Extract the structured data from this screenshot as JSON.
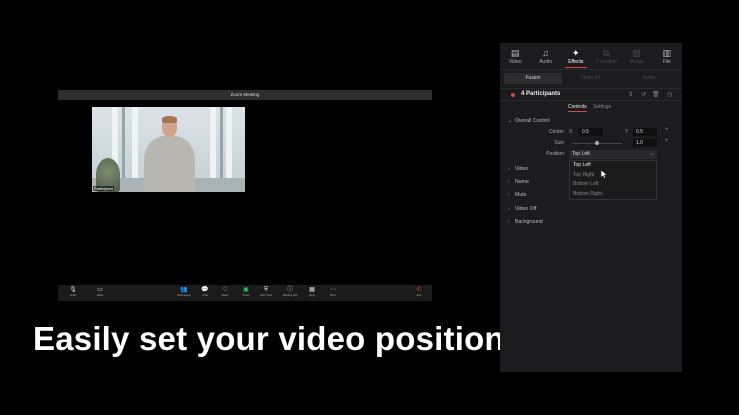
{
  "zoom": {
    "title": "Zoom Meeting",
    "participant_label": "Participant",
    "toolbar": [
      {
        "name": "audio",
        "icon": "microphone-icon",
        "glyph": "🎙",
        "label": "Audio"
      },
      {
        "name": "video",
        "icon": "camera-icon",
        "glyph": "▭",
        "label": "Video"
      },
      {
        "name": "participants",
        "icon": "people-icon",
        "glyph": "👥",
        "label": "Participants"
      },
      {
        "name": "chat",
        "icon": "chat-icon",
        "glyph": "💬",
        "label": "Chat"
      },
      {
        "name": "react",
        "icon": "heart-icon",
        "glyph": "♡",
        "label": "React"
      },
      {
        "name": "share",
        "icon": "share-screen-icon",
        "glyph": "▣",
        "label": "Share"
      },
      {
        "name": "host-tools",
        "icon": "shield-icon",
        "glyph": "⛨",
        "label": "Host Tools"
      },
      {
        "name": "meeting-info",
        "icon": "info-icon",
        "glyph": "ⓘ",
        "label": "Meeting Info"
      },
      {
        "name": "apps",
        "icon": "apps-icon",
        "glyph": "▦",
        "label": "Apps"
      },
      {
        "name": "more",
        "icon": "more-icon",
        "glyph": "⋯",
        "label": "More"
      },
      {
        "name": "leave",
        "icon": "leave-icon",
        "glyph": "✆",
        "label": "End"
      }
    ]
  },
  "headline": "Easily set your video position",
  "panel": {
    "tabs": [
      {
        "label": "Video",
        "icon": "video-icon",
        "glyph": "▤",
        "state": "normal"
      },
      {
        "label": "Audio",
        "icon": "music-note-icon",
        "glyph": "♫",
        "state": "normal"
      },
      {
        "label": "Effects",
        "icon": "magic-wand-icon",
        "glyph": "✦",
        "state": "active"
      },
      {
        "label": "Transition",
        "icon": "transition-icon",
        "glyph": "⧉",
        "state": "dim"
      },
      {
        "label": "Image",
        "icon": "image-icon",
        "glyph": "▨",
        "state": "dim"
      },
      {
        "label": "File",
        "icon": "file-icon",
        "glyph": "▥",
        "state": "normal"
      }
    ],
    "subtabs": [
      "Fusion",
      "Open FX",
      "Audio"
    ],
    "effect_title": "4 Participants",
    "control_tabs": {
      "controls": "Controls",
      "settings": "Settings"
    },
    "overall_control": "Overall Control",
    "params": {
      "center_label": "Center",
      "x_label": "X",
      "x_value": "0.5",
      "y_label": "Y",
      "y_value": "0.5",
      "size_label": "Size",
      "size_value": "1.0",
      "size_fraction": 0.5,
      "position_label": "Position",
      "position_value": "Top Left"
    },
    "position_options": [
      "Top Left",
      "Top Right",
      "Bottom Left",
      "Bottom Right"
    ],
    "sections": [
      "Video",
      "Name",
      "Mute",
      "Video Off",
      "Background"
    ],
    "colors": {
      "accent": "#e0483f",
      "share": "#2fcb6a"
    }
  }
}
